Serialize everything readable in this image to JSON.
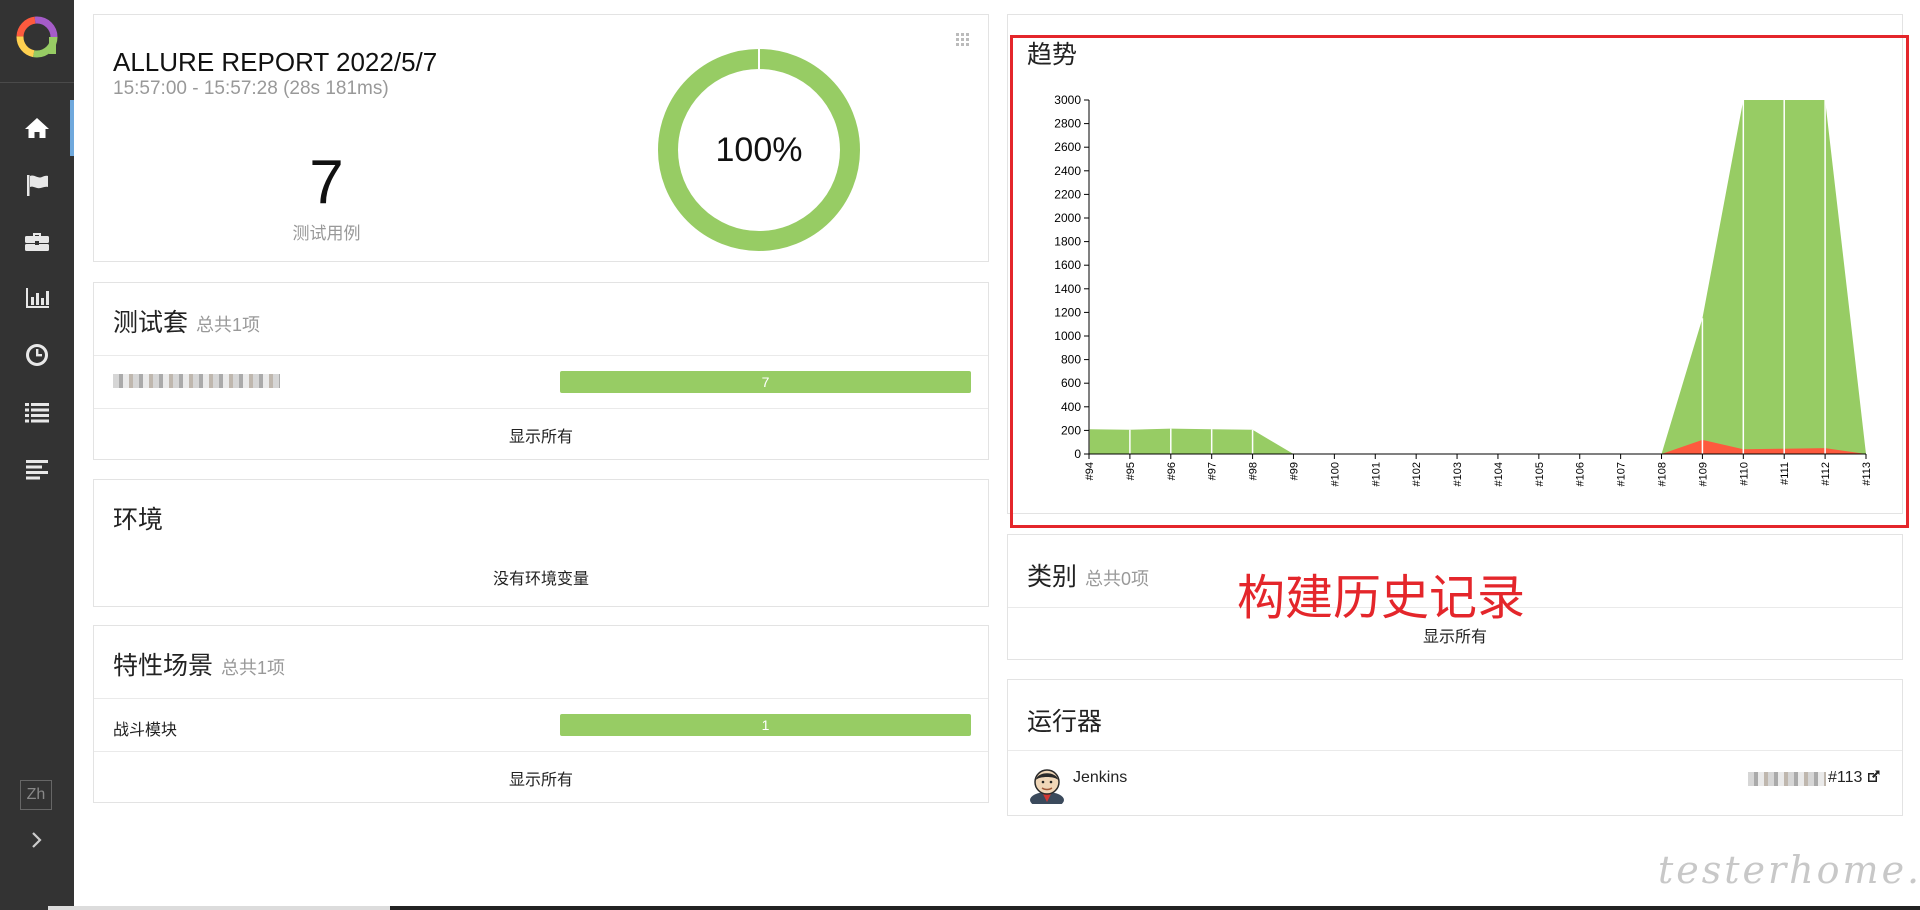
{
  "nav": {
    "items": [
      "overview",
      "categories",
      "suites",
      "graphs",
      "timeline",
      "behaviors",
      "packages"
    ],
    "lang": "Zh"
  },
  "summary": {
    "title": "ALLURE REPORT 2022/5/7",
    "time": "15:57:00 - 15:57:28 (28s 181ms)",
    "total": "7",
    "total_label": "测试用例",
    "percent": "100%",
    "pass_fraction": 1.0
  },
  "suites": {
    "title": "测试套",
    "count": "总共1项",
    "rows": [
      {
        "value": "7"
      }
    ],
    "show_all": "显示所有"
  },
  "environment": {
    "title": "环境",
    "empty": "没有环境变量"
  },
  "features": {
    "title": "特性场景",
    "count": "总共1项",
    "rows": [
      {
        "label": "战斗模块",
        "value": "1"
      }
    ],
    "show_all": "显示所有"
  },
  "trend": {
    "title": "趋势"
  },
  "categories": {
    "title": "类别",
    "count": "总共0项",
    "show_all": "显示所有"
  },
  "executors": {
    "title": "运行器",
    "name": "Jenkins",
    "build": "#113"
  },
  "annotation": "构建历史记录",
  "watermark": "testerhome.com",
  "chart_data": {
    "type": "area",
    "title": "",
    "xlabel": "",
    "ylabel": "",
    "x": [
      "#94",
      "#95",
      "#96",
      "#97",
      "#98",
      "#99",
      "#100",
      "#101",
      "#102",
      "#103",
      "#104",
      "#105",
      "#106",
      "#107",
      "#108",
      "#109",
      "#110",
      "#111",
      "#112",
      "#113"
    ],
    "ylim": [
      0,
      3000
    ],
    "yticks": [
      0,
      200,
      400,
      600,
      800,
      1000,
      1200,
      1400,
      1600,
      1800,
      2000,
      2200,
      2400,
      2600,
      2800,
      3000
    ],
    "grid": false,
    "series": [
      {
        "color": "#97cc64",
        "values": [
          210,
          205,
          215,
          210,
          205,
          0,
          0,
          0,
          0,
          0,
          0,
          0,
          0,
          0,
          0,
          1150,
          3000,
          3000,
          3000,
          0
        ]
      },
      {
        "color": "#fd5a3e",
        "values": [
          0,
          0,
          0,
          0,
          0,
          0,
          0,
          0,
          0,
          0,
          0,
          0,
          0,
          0,
          0,
          120,
          40,
          45,
          50,
          0
        ]
      }
    ]
  }
}
